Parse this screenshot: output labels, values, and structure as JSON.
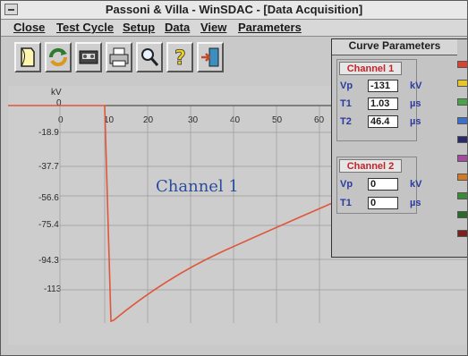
{
  "window": {
    "title": "Passoni & Villa - WinSDAC - [Data Acquisition]"
  },
  "menu": [
    "Close",
    "Test Cycle",
    "Setup",
    "Data",
    "View",
    "Parameters"
  ],
  "toolbar": {
    "icons": [
      "open-file-icon",
      "refresh-icon",
      "tape-icon",
      "print-icon",
      "zoom-icon",
      "help-icon",
      "exit-icon"
    ]
  },
  "plot": {
    "y_unit": "kV",
    "y_ticks": [
      "0",
      "-18.9",
      "-37.7",
      "-56.6",
      "-75.4",
      "-94.3",
      "-113"
    ],
    "x_ticks": [
      "0",
      "10",
      "20",
      "30",
      "40",
      "50",
      "60"
    ],
    "channel_label": "Channel 1",
    "trace_color": "#e0563a"
  },
  "curve_params": {
    "title": "Curve Parameters",
    "channel1": {
      "label": "Channel 1",
      "vp_label": "Vp",
      "vp": "-131",
      "vp_unit": "kV",
      "t1_label": "T1",
      "t1": "1.03",
      "t1_unit": "µs",
      "t2_label": "T2",
      "t2": "46.4",
      "t2_unit": "µs"
    },
    "channel2": {
      "label": "Channel 2",
      "vp_label": "Vp",
      "vp": "0",
      "vp_unit": "kV",
      "t1_label": "T1",
      "t1": "0",
      "t1_unit": "µs"
    },
    "swatches": [
      "#d8442f",
      "#e6c62a",
      "#4aa347",
      "#3c6fc8",
      "#2a2a6a",
      "#a04ba0",
      "#d07a28",
      "#3a8a3a",
      "#2a6a2a",
      "#7a2222"
    ]
  }
}
